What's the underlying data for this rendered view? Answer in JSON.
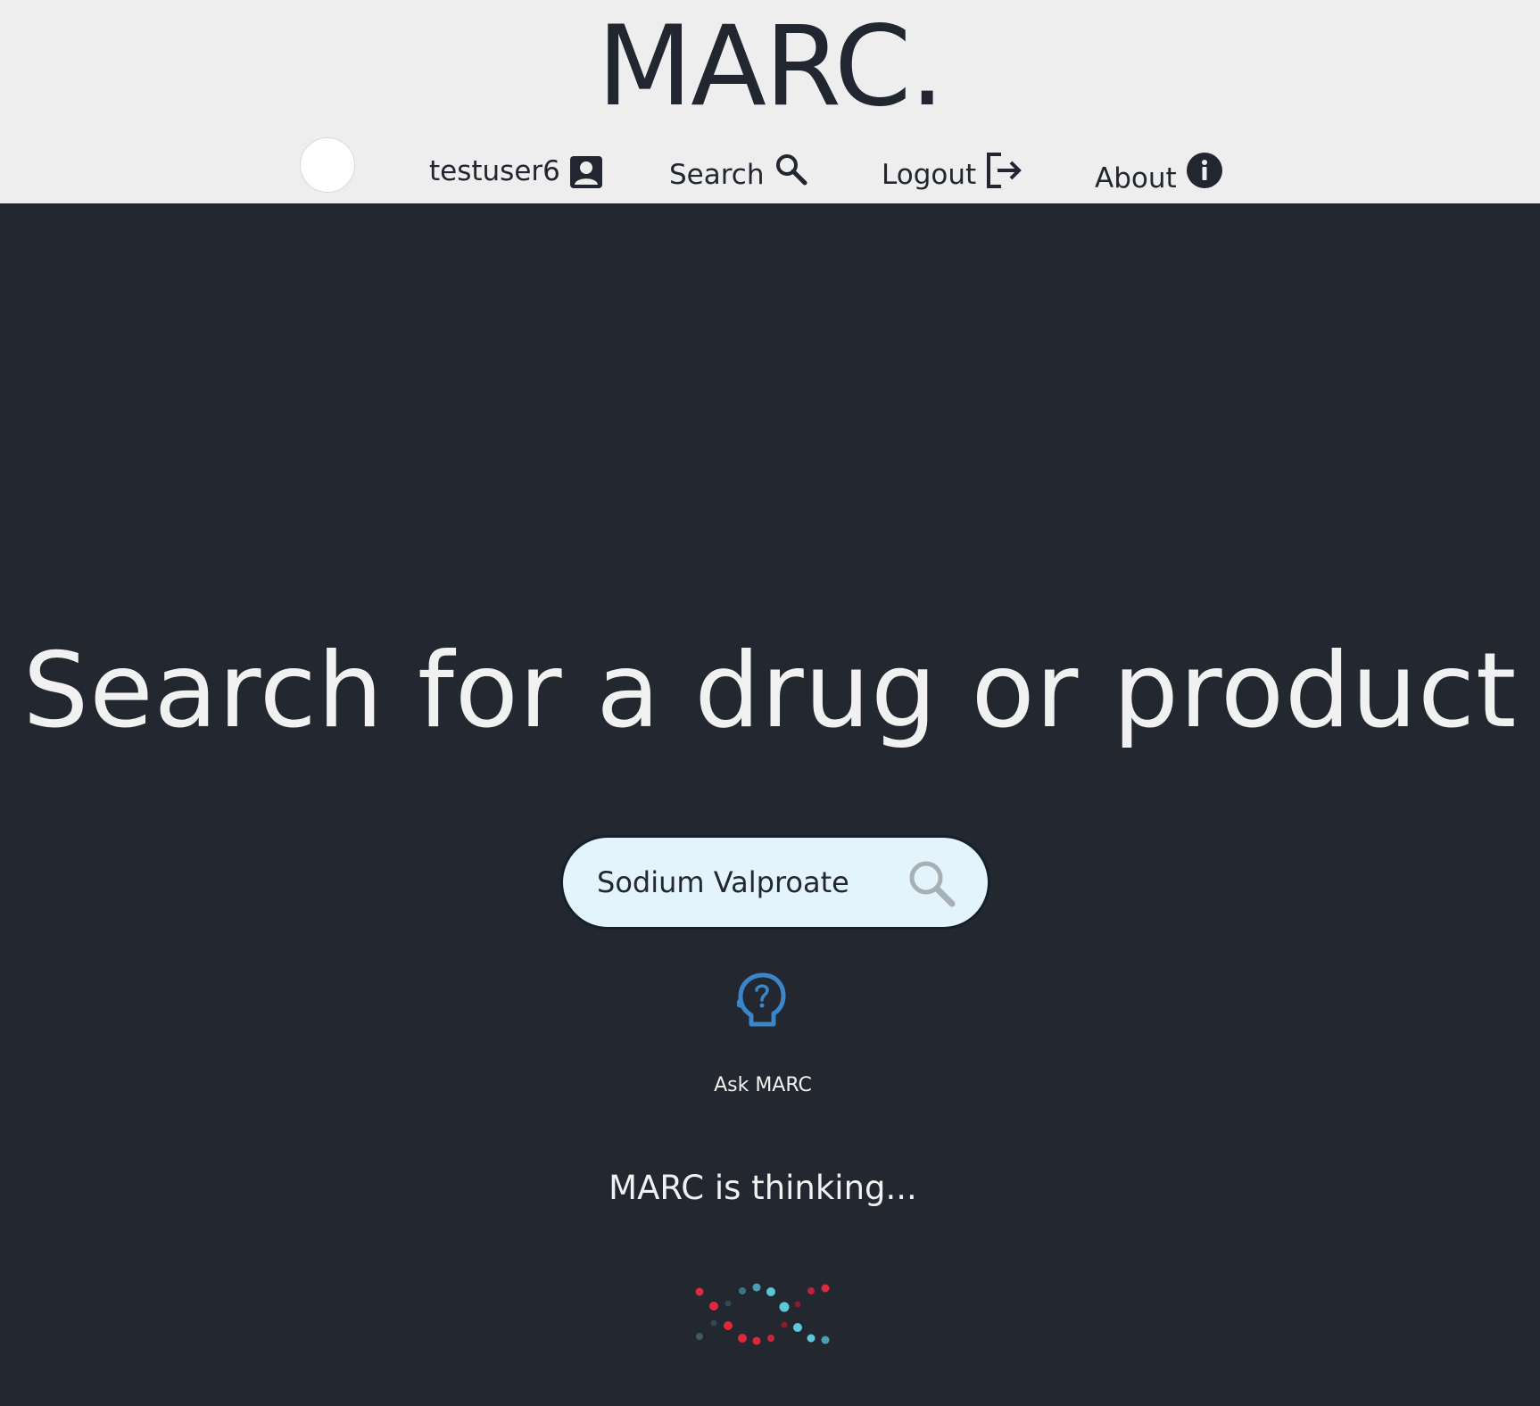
{
  "header": {
    "logo": "MARC.",
    "nav": {
      "user": {
        "label": "testuser6",
        "icon": "user-account-icon"
      },
      "search": {
        "label": "Search",
        "icon": "search-icon"
      },
      "logout": {
        "label": "Logout",
        "icon": "logout-icon"
      },
      "about": {
        "label": "About",
        "icon": "info-icon"
      }
    }
  },
  "main": {
    "title": "Search for a drug or product",
    "search": {
      "value": "Sodium Valproate",
      "icon": "search-icon"
    },
    "ask": {
      "label": "Ask MARC",
      "icon": "head-question-icon"
    },
    "status": "MARC is thinking..."
  },
  "colors": {
    "background": "#232730",
    "header_bg": "#eeeeee",
    "search_bg": "#e4f4fd",
    "accent_blue": "#3a86c8",
    "loader_red": "#e0283c",
    "loader_teal": "#5cc8d8"
  }
}
